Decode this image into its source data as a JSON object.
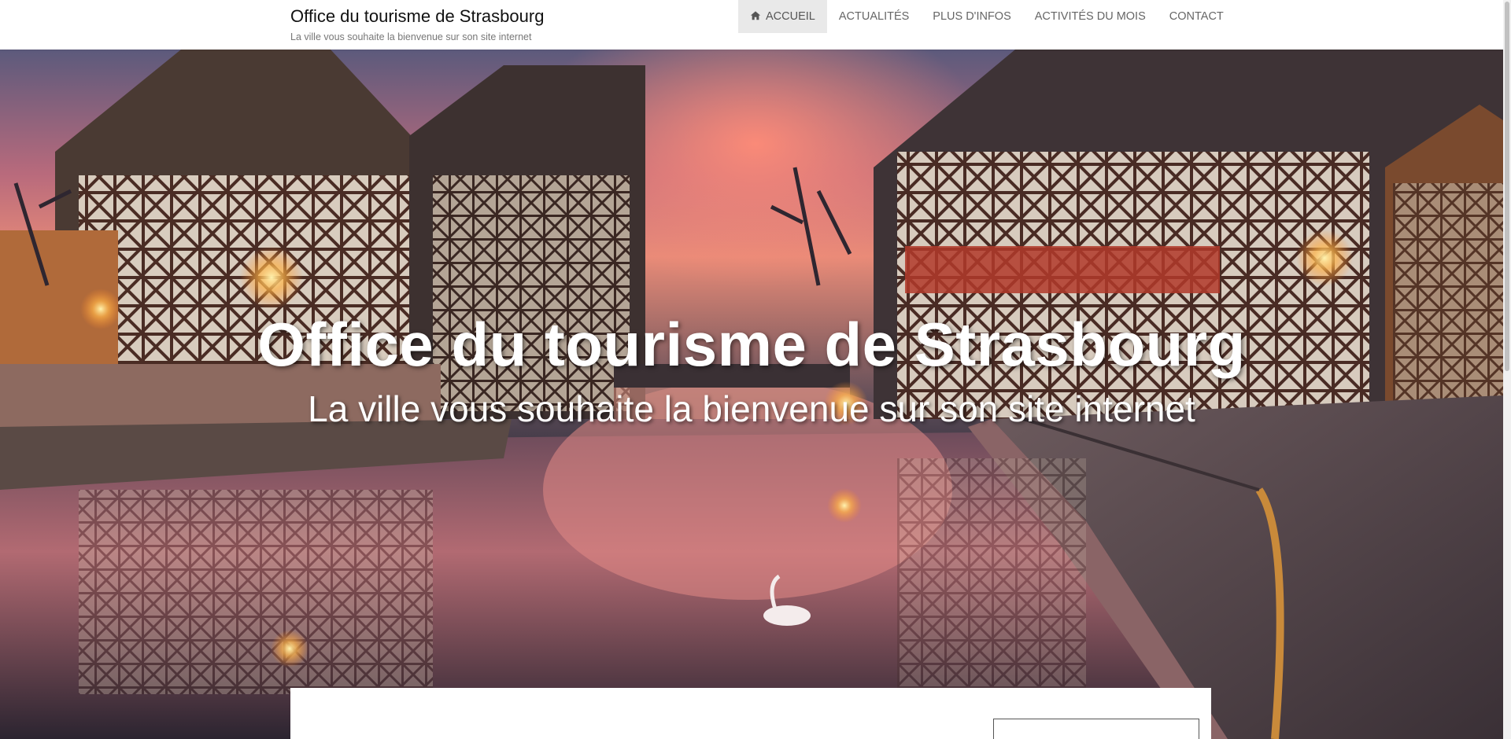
{
  "header": {
    "site_title": "Office du tourisme de Strasbourg",
    "tagline": "La ville vous souhaite la bienvenue sur son site internet"
  },
  "nav": {
    "items": [
      {
        "label": "ACCUEIL",
        "icon": "home-icon",
        "active": true
      },
      {
        "label": "ACTUALITÉS"
      },
      {
        "label": "PLUS D'INFOS"
      },
      {
        "label": "ACTIVITÉS DU MOIS"
      },
      {
        "label": "CONTACT"
      }
    ]
  },
  "hero": {
    "title": "Office du tourisme de Strasbourg",
    "subtitle": "La ville vous souhaite la bienvenue sur son site internet"
  },
  "colors": {
    "nav_active_bg": "#e9e9e9",
    "nav_text": "#666666",
    "hero_text": "#ffffff"
  }
}
